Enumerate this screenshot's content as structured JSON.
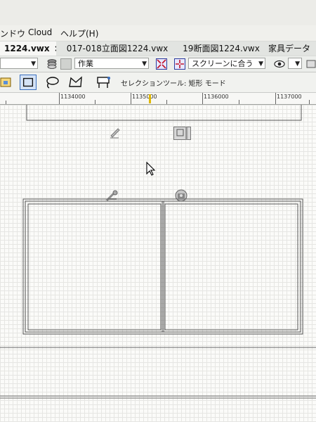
{
  "menubar": {
    "items": [
      {
        "label": "ンドウ"
      },
      {
        "label": "Cloud"
      },
      {
        "label": "ヘルプ(H)"
      }
    ]
  },
  "tabs": [
    {
      "label": "1224.vwx",
      "active": true,
      "close": "×"
    },
    {
      "label": "017-018立面図1224.vwx",
      "active": false
    },
    {
      "label": "19断面図1224.vwx",
      "active": false
    },
    {
      "label": "家具データ",
      "active": false
    }
  ],
  "viewbar": {
    "layer_dropdown": "作業",
    "fit_dropdown": "スクリーンに合う"
  },
  "modebar": {
    "status_text": "セレクションツール: 矩形 モード"
  },
  "ruler": {
    "labels": [
      "1134000",
      "1135000",
      "1136000",
      "1137000"
    ]
  },
  "colors": {
    "canvas_line": "#555555",
    "selection_accent": "#3a6fbf",
    "ruler_marker": "#e0b800"
  },
  "icons": [
    "edit-pencil-icon",
    "object-info-icon",
    "mouse-cursor-icon",
    "wrench-handle-icon",
    "camera-object-icon"
  ]
}
